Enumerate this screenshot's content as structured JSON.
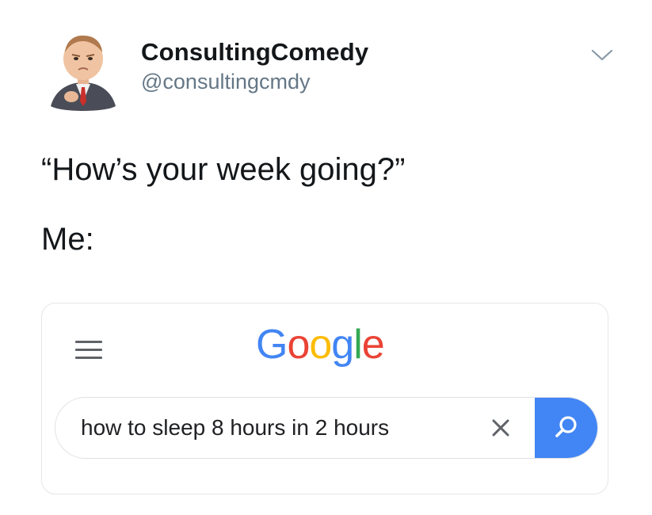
{
  "tweet": {
    "display_name": "ConsultingComedy",
    "handle": "@consultingcmdy",
    "line1": "“How’s your week going?”",
    "line2": "Me:"
  },
  "google": {
    "logo_letters": [
      {
        "char": "G",
        "color": "#4285F4"
      },
      {
        "char": "o",
        "color": "#EA4335"
      },
      {
        "char": "o",
        "color": "#FBBC05"
      },
      {
        "char": "g",
        "color": "#4285F4"
      },
      {
        "char": "l",
        "color": "#34A853"
      },
      {
        "char": "e",
        "color": "#EA4335"
      }
    ],
    "search_query": "how to sleep 8 hours in 2 hours",
    "search_button_color": "#4285F4"
  },
  "icons": {
    "menu": "hamburger-menu-icon",
    "clear": "close-icon",
    "search": "search-icon",
    "more": "chevron-down-icon"
  }
}
